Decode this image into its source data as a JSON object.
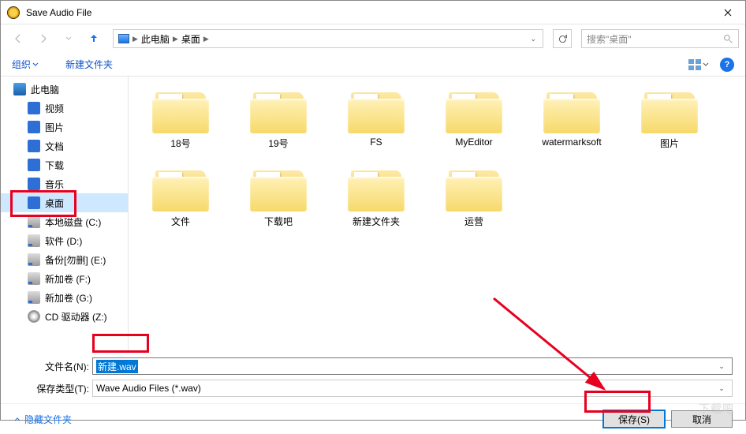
{
  "window": {
    "title": "Save Audio File"
  },
  "breadcrumb": {
    "seg1": "此电脑",
    "seg2": "桌面"
  },
  "search": {
    "placeholder": "搜索\"桌面\""
  },
  "toolbar": {
    "organize": "组织",
    "new_folder": "新建文件夹"
  },
  "sidebar": {
    "items": [
      {
        "label": "此电脑",
        "icon": "pc",
        "indent": 0
      },
      {
        "label": "视频",
        "icon": "blue",
        "indent": 1
      },
      {
        "label": "图片",
        "icon": "blue",
        "indent": 1
      },
      {
        "label": "文档",
        "icon": "blue",
        "indent": 1
      },
      {
        "label": "下载",
        "icon": "blue",
        "indent": 1
      },
      {
        "label": "音乐",
        "icon": "blue",
        "indent": 1
      },
      {
        "label": "桌面",
        "icon": "blue",
        "indent": 1,
        "selected": true
      },
      {
        "label": "本地磁盘 (C:)",
        "icon": "drive",
        "indent": 1
      },
      {
        "label": "软件 (D:)",
        "icon": "drive",
        "indent": 1
      },
      {
        "label": "备份[勿删] (E:)",
        "icon": "drive",
        "indent": 1
      },
      {
        "label": "新加卷 (F:)",
        "icon": "drive",
        "indent": 1
      },
      {
        "label": "新加卷 (G:)",
        "icon": "drive",
        "indent": 1
      },
      {
        "label": "CD 驱动器 (Z:)",
        "icon": "cd",
        "indent": 1
      }
    ]
  },
  "grid": {
    "items": [
      {
        "label": "18号"
      },
      {
        "label": "19号"
      },
      {
        "label": "FS"
      },
      {
        "label": "MyEditor"
      },
      {
        "label": "watermarksoft"
      },
      {
        "label": "图片"
      },
      {
        "label": "文件"
      },
      {
        "label": "下载吧"
      },
      {
        "label": "新建文件夹"
      },
      {
        "label": "运营"
      }
    ]
  },
  "fields": {
    "filename_label": "文件名(N):",
    "filename_value": "新建.wav",
    "type_label": "保存类型(T):",
    "type_value": "Wave Audio Files (*.wav)"
  },
  "footer": {
    "hide_folders": "隐藏文件夹",
    "save": "保存(S)",
    "cancel": "取消"
  },
  "watermark": "下载吧"
}
